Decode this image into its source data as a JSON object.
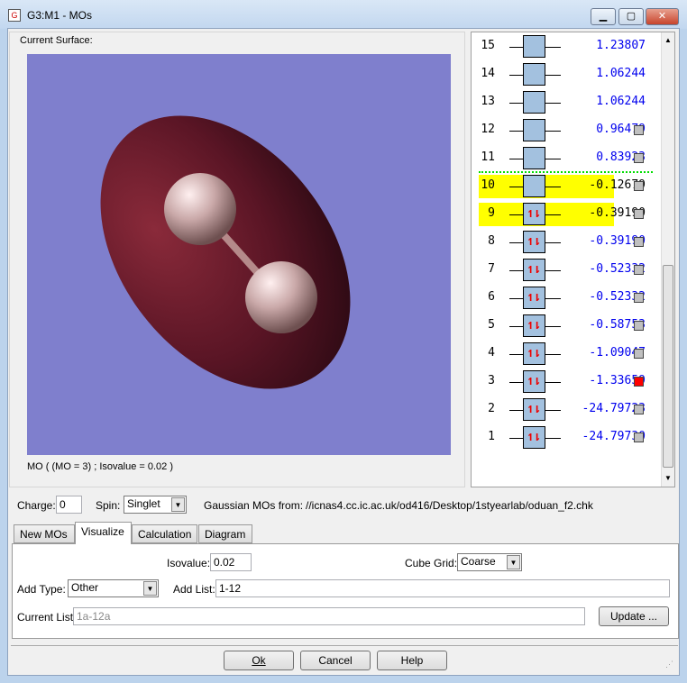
{
  "window": {
    "title": "G3:M1 - MOs",
    "minimize": "▁",
    "maximize": "▢",
    "close": "✕"
  },
  "surface": {
    "label": "Current Surface:",
    "caption": "MO ( (MO = 3) ; Isovalue = 0.02 )"
  },
  "mos": [
    {
      "n": "15",
      "energy": "1.23807",
      "occ": 0,
      "sel": null
    },
    {
      "n": "14",
      "energy": "1.06244",
      "occ": 0,
      "sel": null
    },
    {
      "n": "13",
      "energy": "1.06244",
      "occ": 0,
      "sel": null
    },
    {
      "n": "12",
      "energy": "0.96479",
      "occ": 0,
      "sel": "off"
    },
    {
      "n": "11",
      "energy": "0.83923",
      "occ": 0,
      "sel": "off"
    },
    {
      "n": "10",
      "energy": "-0.12679",
      "occ": 0,
      "sel": "off",
      "highlight": true
    },
    {
      "n": "9",
      "energy": "-0.39190",
      "occ": 2,
      "sel": "off",
      "highlight": true
    },
    {
      "n": "8",
      "energy": "-0.39190",
      "occ": 2,
      "sel": "off"
    },
    {
      "n": "7",
      "energy": "-0.52332",
      "occ": 2,
      "sel": "off"
    },
    {
      "n": "6",
      "energy": "-0.52332",
      "occ": 2,
      "sel": "off"
    },
    {
      "n": "5",
      "energy": "-0.58753",
      "occ": 2,
      "sel": "off"
    },
    {
      "n": "4",
      "energy": "-1.09047",
      "occ": 2,
      "sel": "off"
    },
    {
      "n": "3",
      "energy": "-1.33659",
      "occ": 2,
      "sel": "on"
    },
    {
      "n": "2",
      "energy": "-24.79723",
      "occ": 2,
      "sel": "off"
    },
    {
      "n": "1",
      "energy": "-24.79730",
      "occ": 2,
      "sel": "off"
    }
  ],
  "colors": {
    "highlight": "#ffff00",
    "selected": "#ff0000",
    "homo_lumo_line": "#00dd00",
    "energy": "#0000ee"
  },
  "options": {
    "charge_label": "Charge:",
    "charge": "0",
    "spin_label": "Spin:",
    "spin": "Singlet",
    "source_label": "Gaussian MOs from:",
    "source": "//icnas4.cc.ic.ac.uk/od416/Desktop/1styearlab/oduan_f2.chk"
  },
  "tabs": [
    "New MOs",
    "Visualize",
    "Calculation",
    "Diagram"
  ],
  "visualize": {
    "isovalue_label": "Isovalue:",
    "isovalue": "0.02",
    "cube_grid_label": "Cube Grid:",
    "cube_grid": "Coarse",
    "add_type_label": "Add Type:",
    "add_type": "Other",
    "add_list_label": "Add List:",
    "add_list": "1-12",
    "current_list_label": "Current List:",
    "current_list": "1a-12a",
    "update": "Update ..."
  },
  "buttons": {
    "ok": "Ok",
    "cancel": "Cancel",
    "help": "Help"
  }
}
